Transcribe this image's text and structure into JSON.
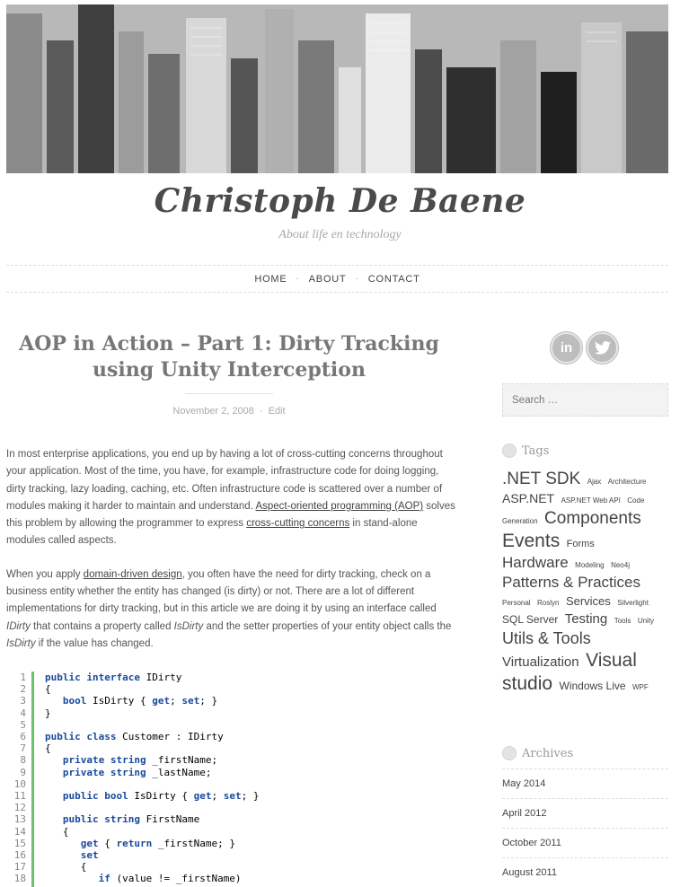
{
  "site": {
    "title": "Christoph De Baene",
    "description": "About life en technology"
  },
  "nav": {
    "items": [
      {
        "label": "HOME"
      },
      {
        "label": "ABOUT"
      },
      {
        "label": "CONTACT"
      }
    ],
    "separator": "·"
  },
  "post": {
    "title": "AOP in Action – Part 1: Dirty Tracking using Unity Interception",
    "date": "November 2, 2008",
    "edit": "Edit",
    "meta_sep": "·",
    "p1_part1": "In most enterprise applications, you end up by having a lot of cross-cutting concerns throughout your application. Most of the time, you have, for example, infrastructure code for doing logging, dirty tracking, lazy loading, caching, etc. Often infrastructure code is scattered over a number of modules making it harder to maintain and understand. ",
    "p1_link1": "Aspect-oriented programming (AOP)",
    "p1_part2": " solves this problem by allowing the programmer to express ",
    "p1_link2": "cross-cutting concerns",
    "p1_part3": " in stand-alone modules called aspects.",
    "p2_part1": "When you apply ",
    "p2_link1": "domain-driven design",
    "p2_part2": ", you often have the need for dirty tracking, check on a business entity whether the entity has changed (is dirty) or not. There are a lot of different implementations for dirty tracking, but in this article we are doing it by using an interface called ",
    "p2_em1": "IDirty",
    "p2_part3": " that contains a property called ",
    "p2_em2": "IsDirty",
    "p2_part4": " and the setter properties of your entity object calls the ",
    "p2_em3": "IsDirty",
    "p2_part5": " if the value has changed."
  },
  "code": {
    "line_numbers": [
      "1",
      "2",
      "3",
      "4",
      "5",
      "6",
      "7",
      "8",
      "9",
      "10",
      "11",
      "12",
      "13",
      "14",
      "15",
      "16",
      "17",
      "18"
    ],
    "lines": [
      "public interface IDirty",
      "{",
      "   bool IsDirty { get; set; }",
      "}",
      "",
      "public class Customer : IDirty",
      "{",
      "   private string _firstName;",
      "   private string _lastName;",
      "",
      "   public bool IsDirty { get; set; }",
      "",
      "   public string FirstName",
      "   {",
      "      get { return _firstName; }",
      "      set",
      "      {",
      "         if (value != _firstName)"
    ]
  },
  "sidebar": {
    "social": [
      {
        "label": "in",
        "icon": "linkedin-icon"
      },
      {
        "label": "🐦",
        "icon": "twitter-icon"
      }
    ],
    "search_placeholder": "Search …",
    "tags_title": "Tags",
    "tags": [
      {
        "label": ".NET SDK",
        "size": 19
      },
      {
        "label": "Ajax",
        "size": 8
      },
      {
        "label": "Architecture",
        "size": 8
      },
      {
        "label": "ASP.NET",
        "size": 14
      },
      {
        "label": "ASP.NET Web API",
        "size": 8
      },
      {
        "label": "Code Generation",
        "size": 8
      },
      {
        "label": "Components",
        "size": 19
      },
      {
        "label": "Events",
        "size": 21
      },
      {
        "label": "Forms",
        "size": 11
      },
      {
        "label": "Hardware",
        "size": 17
      },
      {
        "label": "Modeling",
        "size": 8
      },
      {
        "label": "Neo4j",
        "size": 8
      },
      {
        "label": "Patterns & Practices",
        "size": 17
      },
      {
        "label": "Personal",
        "size": 8
      },
      {
        "label": "Roslyn",
        "size": 8
      },
      {
        "label": "Services",
        "size": 13
      },
      {
        "label": "Silverlight",
        "size": 8
      },
      {
        "label": "SQL Server",
        "size": 12
      },
      {
        "label": "Testing",
        "size": 15
      },
      {
        "label": "Tools",
        "size": 8
      },
      {
        "label": "Unity",
        "size": 8
      },
      {
        "label": "Utils & Tools",
        "size": 18
      },
      {
        "label": "Virtualization",
        "size": 15
      },
      {
        "label": "Visual studio",
        "size": 21
      },
      {
        "label": "Windows Live",
        "size": 12
      },
      {
        "label": "WPF",
        "size": 8
      }
    ],
    "archives_title": "Archives",
    "archives": [
      {
        "label": "May 2014"
      },
      {
        "label": "April 2012"
      },
      {
        "label": "October 2011"
      },
      {
        "label": "August 2011"
      }
    ]
  }
}
